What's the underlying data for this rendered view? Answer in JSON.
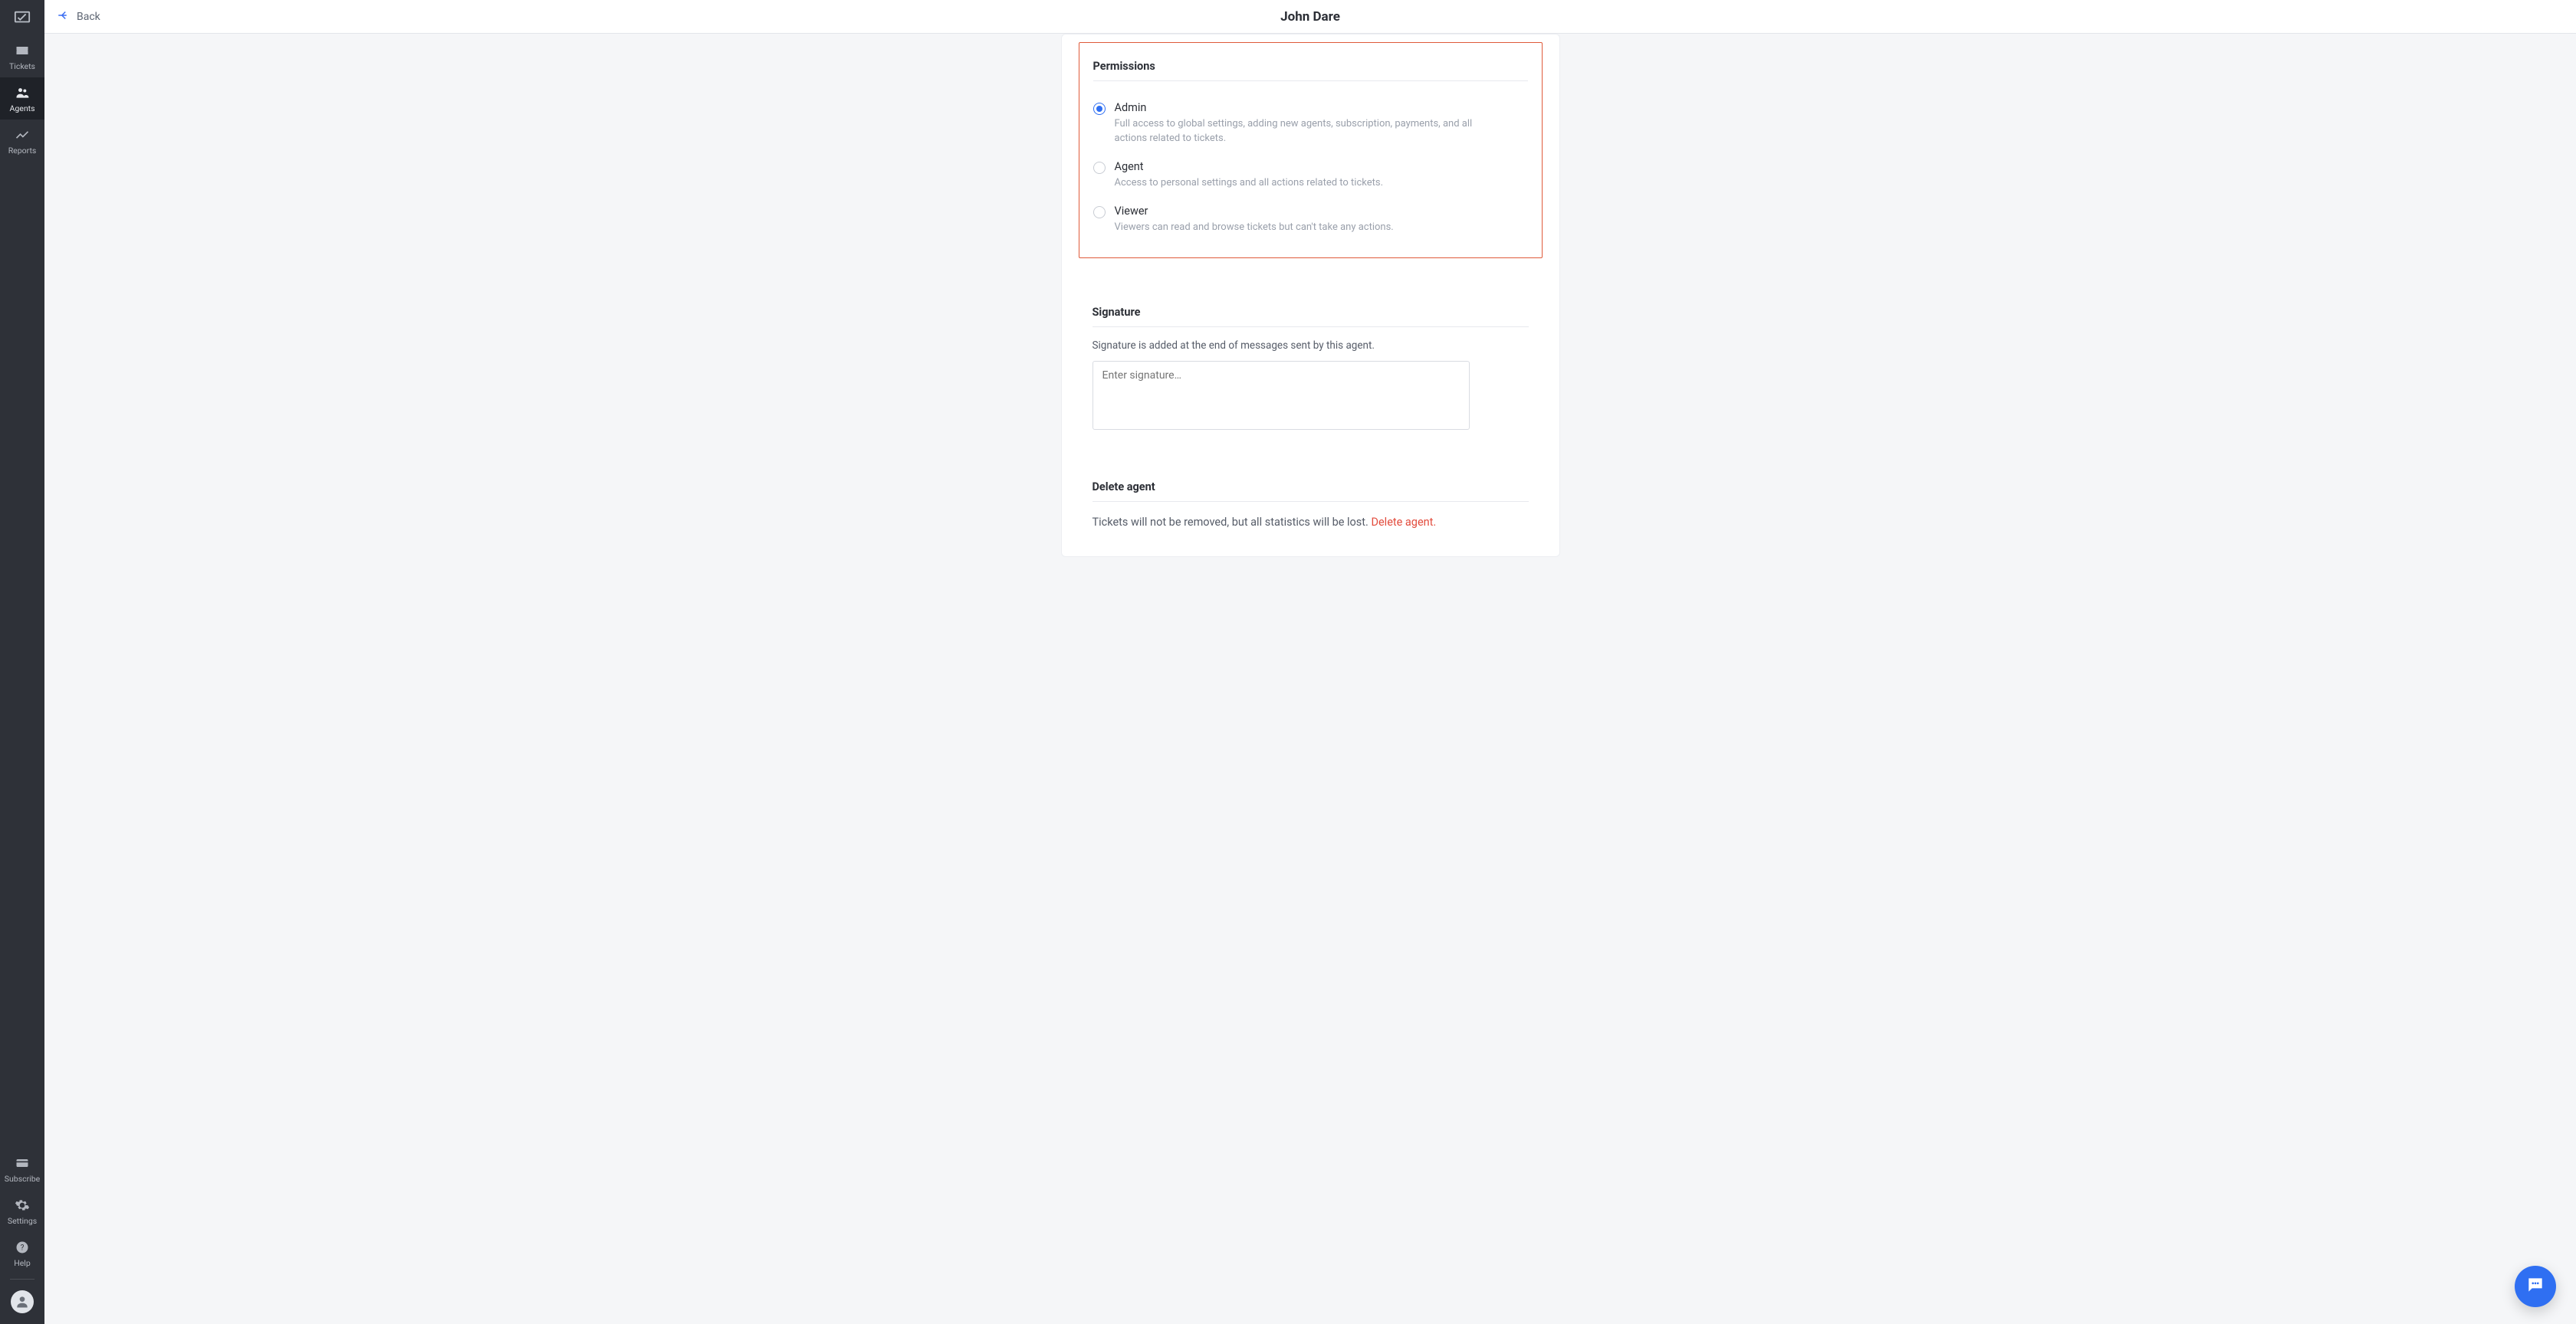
{
  "sidebar": {
    "nav": [
      {
        "id": "tickets",
        "label": "Tickets",
        "icon": "ticket-icon"
      },
      {
        "id": "agents",
        "label": "Agents",
        "icon": "people-icon",
        "active": true
      },
      {
        "id": "reports",
        "label": "Reports",
        "icon": "trend-icon"
      }
    ],
    "bottom": [
      {
        "id": "subscribe",
        "label": "Subscribe",
        "icon": "card-icon"
      },
      {
        "id": "settings",
        "label": "Settings",
        "icon": "gear-icon"
      },
      {
        "id": "help",
        "label": "Help",
        "icon": "help-icon"
      }
    ]
  },
  "header": {
    "back_label": "Back",
    "title": "John Dare"
  },
  "permissions": {
    "section_title": "Permissions",
    "selected": "admin",
    "options": [
      {
        "id": "admin",
        "label": "Admin",
        "description": "Full access to global settings, adding new agents, subscription, payments, and all actions related to tickets."
      },
      {
        "id": "agent",
        "label": "Agent",
        "description": "Access to personal settings and all actions related to tickets."
      },
      {
        "id": "viewer",
        "label": "Viewer",
        "description": "Viewers can read and browse tickets but can't take any actions."
      }
    ]
  },
  "signature": {
    "section_title": "Signature",
    "description": "Signature is added at the end of messages sent by this agent.",
    "placeholder": "Enter signature…",
    "value": ""
  },
  "delete": {
    "section_title": "Delete agent",
    "text": "Tickets will not be removed, but all statistics will be lost. ",
    "link_label": "Delete agent."
  },
  "colors": {
    "accent": "#2f6ff2",
    "danger": "#e24b3c",
    "highlight_border": "#df5a3a"
  }
}
